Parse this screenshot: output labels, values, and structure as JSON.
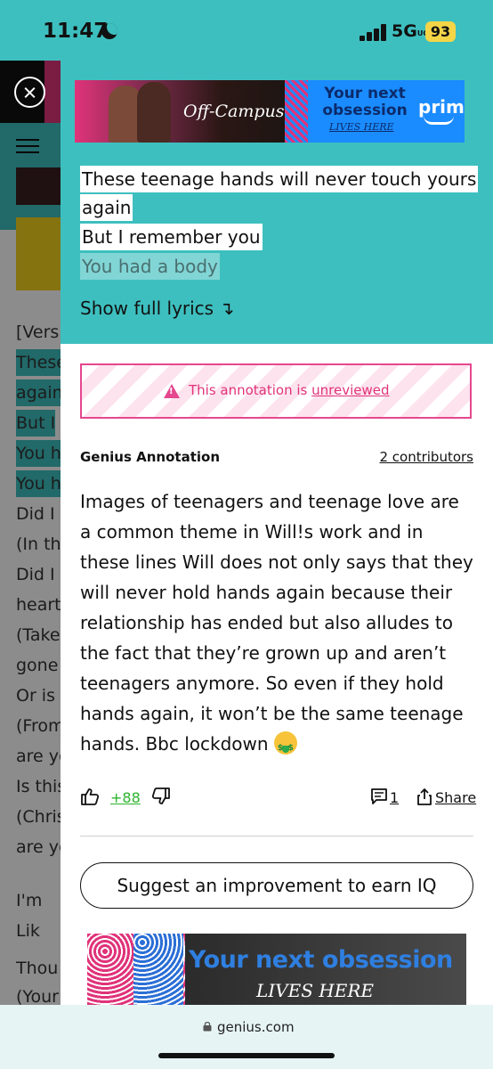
{
  "status_bar": {
    "time": "11:47",
    "network": "5G",
    "network_suffix": "UC",
    "battery": "93",
    "icons": [
      "moon-icon",
      "signal-icon",
      "battery-icon"
    ]
  },
  "background_page": {
    "lines": [
      "[Vers",
      "These",
      "again",
      "But I",
      "You h",
      "You h",
      "Did I",
      "(In th",
      "Did I",
      "heart",
      "(Take",
      "gone",
      "Or is",
      "(From",
      "are yo",
      "Is this",
      "(Chris",
      "are yo",
      "I'm",
      "Lik",
      "Thou",
      "(Your"
    ]
  },
  "annotation_panel": {
    "ad_top": {
      "show_title": "Off-Campus",
      "headline": "Your next obsession",
      "tagline": "LIVES HERE",
      "brand": "prime"
    },
    "lyrics": [
      "These teenage hands will never touch yours",
      "again",
      "But I remember you",
      "You had a body"
    ],
    "show_full_lyrics": "Show full lyrics ↴",
    "warning": {
      "text": "This annotation is ",
      "link": "unreviewed"
    },
    "annotation_label": "Genius Annotation",
    "contributors": "2 contributors",
    "body": "Images of teenagers and teenage love are a common theme in Will!s work and in these lines Will does not only says that they will never hold hands again because their relationship has ended but also alludes to the fact that they’re grown up and aren’t teenagers anymore. So even if they hold hands again, it won’t be the same teenage hands. Bbc lockdown",
    "emoji": "money-mouth-face",
    "upvotes": "+88",
    "comment_count": "1",
    "share_label": "Share",
    "suggest_button": "Suggest an improvement to earn IQ",
    "ad_bottom": {
      "headline": "Your next obsession",
      "tagline": "LIVES HERE"
    }
  },
  "browser": {
    "url": "genius.com"
  },
  "colors": {
    "teal": "#3ebfbf",
    "pink": "#e0337a",
    "upvote_green": "#2bb32b"
  }
}
